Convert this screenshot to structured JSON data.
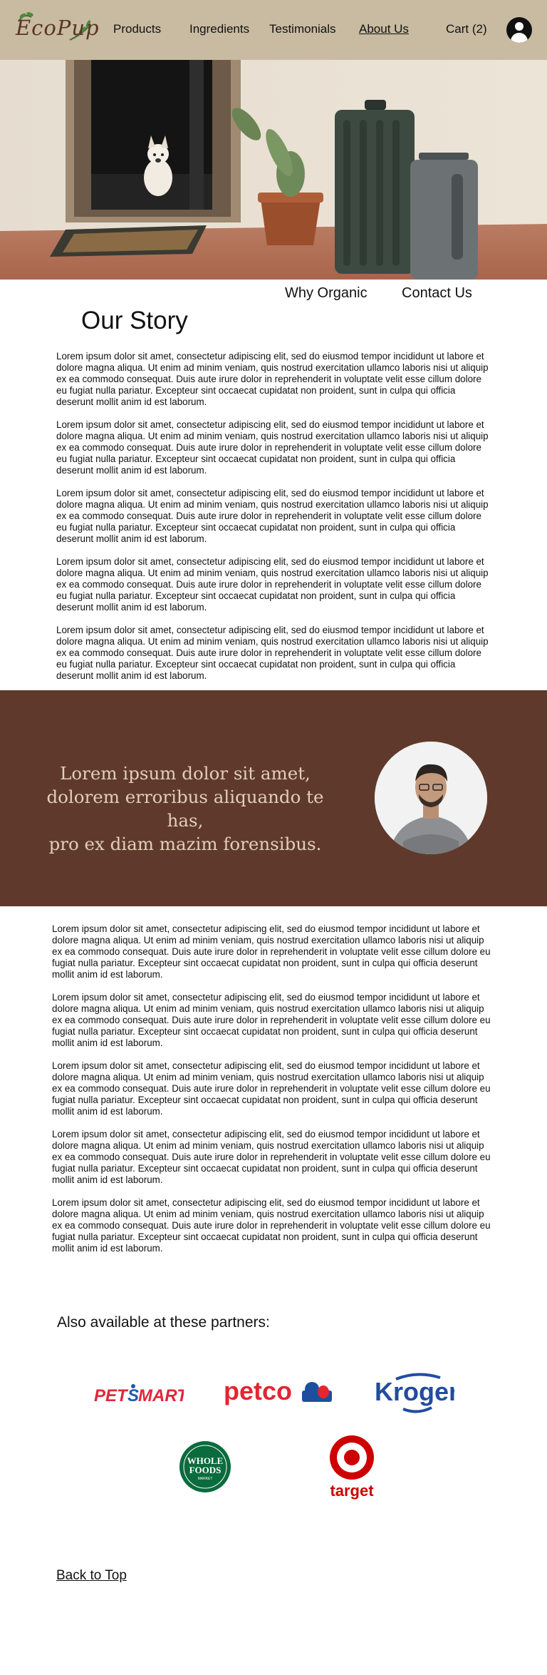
{
  "brand": {
    "logo_text": "EcoPup"
  },
  "nav": {
    "items": [
      "Products",
      "Ingredients",
      "Testimonials",
      "About Us",
      "Cart (2)"
    ],
    "active": "About Us"
  },
  "subnav": {
    "items": [
      "Why Organic",
      "Contact Us"
    ]
  },
  "page": {
    "title": "Our Story"
  },
  "story": {
    "paragraphs_top": [
      "Lorem ipsum dolor sit amet, consectetur adipiscing elit, sed do eiusmod tempor incididunt ut labore et dolore magna aliqua. Ut enim ad minim veniam, quis nostrud exercitation ullamco laboris nisi ut aliquip ex ea commodo consequat. Duis aute irure dolor in reprehenderit in voluptate velit esse cillum dolore eu fugiat nulla pariatur. Excepteur sint occaecat cupidatat non proident, sunt in culpa qui officia deserunt mollit anim id est laborum.",
      "Lorem ipsum dolor sit amet, consectetur adipiscing elit, sed do eiusmod tempor incididunt ut labore et dolore magna aliqua. Ut enim ad minim veniam, quis nostrud exercitation ullamco laboris nisi ut aliquip ex ea commodo consequat. Duis aute irure dolor in reprehenderit in voluptate velit esse cillum dolore eu fugiat nulla pariatur. Excepteur sint occaecat cupidatat non proident, sunt in culpa qui officia deserunt mollit anim id est laborum.",
      "Lorem ipsum dolor sit amet, consectetur adipiscing elit, sed do eiusmod tempor incididunt ut labore et dolore magna aliqua. Ut enim ad minim veniam, quis nostrud exercitation ullamco laboris nisi ut aliquip ex ea commodo consequat. Duis aute irure dolor in reprehenderit in voluptate velit esse cillum dolore eu fugiat nulla pariatur. Excepteur sint occaecat cupidatat non proident, sunt in culpa qui officia deserunt mollit anim id est laborum.",
      "Lorem ipsum dolor sit amet, consectetur adipiscing elit, sed do eiusmod tempor incididunt ut labore et dolore magna aliqua. Ut enim ad minim veniam, quis nostrud exercitation ullamco laboris nisi ut aliquip ex ea commodo consequat. Duis aute irure dolor in reprehenderit in voluptate velit esse cillum dolore eu fugiat nulla pariatur. Excepteur sint occaecat cupidatat non proident, sunt in culpa qui officia deserunt mollit anim id est laborum.",
      "Lorem ipsum dolor sit amet, consectetur adipiscing elit, sed do eiusmod tempor incididunt ut labore et dolore magna aliqua. Ut enim ad minim veniam, quis nostrud exercitation ullamco laboris nisi ut aliquip ex ea commodo consequat. Duis aute irure dolor in reprehenderit in voluptate velit esse cillum dolore eu fugiat nulla pariatur. Excepteur sint occaecat cupidatat non proident, sunt in culpa qui officia deserunt mollit anim id est laborum."
    ],
    "paragraphs_bottom": [
      "Lorem ipsum dolor sit amet, consectetur adipiscing elit, sed do eiusmod tempor incididunt ut labore et dolore magna aliqua. Ut enim ad minim veniam, quis nostrud exercitation ullamco laboris nisi ut aliquip ex ea commodo consequat. Duis aute irure dolor in reprehenderit in voluptate velit esse cillum dolore eu fugiat nulla pariatur. Excepteur sint occaecat cupidatat non proident, sunt in culpa qui officia deserunt mollit anim id est laborum.",
      "Lorem ipsum dolor sit amet, consectetur adipiscing elit, sed do eiusmod tempor incididunt ut labore et dolore magna aliqua. Ut enim ad minim veniam, quis nostrud exercitation ullamco laboris nisi ut aliquip ex ea commodo consequat. Duis aute irure dolor in reprehenderit in voluptate velit esse cillum dolore eu fugiat nulla pariatur. Excepteur sint occaecat cupidatat non proident, sunt in culpa qui officia deserunt mollit anim id est laborum.",
      "Lorem ipsum dolor sit amet, consectetur adipiscing elit, sed do eiusmod tempor incididunt ut labore et dolore magna aliqua. Ut enim ad minim veniam, quis nostrud exercitation ullamco laboris nisi ut aliquip ex ea commodo consequat. Duis aute irure dolor in reprehenderit in voluptate velit esse cillum dolore eu fugiat nulla pariatur. Excepteur sint occaecat cupidatat non proident, sunt in culpa qui officia deserunt mollit anim id est laborum.",
      "Lorem ipsum dolor sit amet, consectetur adipiscing elit, sed do eiusmod tempor incididunt ut labore et dolore magna aliqua. Ut enim ad minim veniam, quis nostrud exercitation ullamco laboris nisi ut aliquip ex ea commodo consequat. Duis aute irure dolor in reprehenderit in voluptate velit esse cillum dolore eu fugiat nulla pariatur. Excepteur sint occaecat cupidatat non proident, sunt in culpa qui officia deserunt mollit anim id est laborum.",
      "Lorem ipsum dolor sit amet, consectetur adipiscing elit, sed do eiusmod tempor incididunt ut labore et dolore magna aliqua. Ut enim ad minim veniam, quis nostrud exercitation ullamco laboris nisi ut aliquip ex ea commodo consequat. Duis aute irure dolor in reprehenderit in voluptate velit esse cillum dolore eu fugiat nulla pariatur. Excepteur sint occaecat cupidatat non proident, sunt in culpa qui officia deserunt mollit anim id est laborum."
    ]
  },
  "quote": {
    "lines": [
      "Lorem ipsum dolor sit amet,",
      "dolorem erroribus aliquando te has,",
      "pro ex diam mazim forensibus."
    ]
  },
  "partners": {
    "title": "Also available at these partners:",
    "logos": {
      "petsmart": {
        "pre": "PET",
        "post": "MART",
        "s": "S"
      },
      "petco": "petco",
      "kroger": "Kroger",
      "wholefoods": [
        "WHOLE",
        "FOODS",
        "MARKET"
      ],
      "target": "target"
    }
  },
  "footer": {
    "back_to_top": "Back to Top"
  },
  "colors": {
    "header_bg": "#c8bba1",
    "quote_band_bg": "#5f3a2c",
    "quote_text": "#e2cfb8",
    "petsmart_red": "#e2263a",
    "petsmart_blue": "#1f5aa8",
    "petco_red": "#e3262f",
    "kroger_blue": "#214ca0",
    "wholefoods_green": "#0a6b3d",
    "target_red": "#cc0000"
  }
}
